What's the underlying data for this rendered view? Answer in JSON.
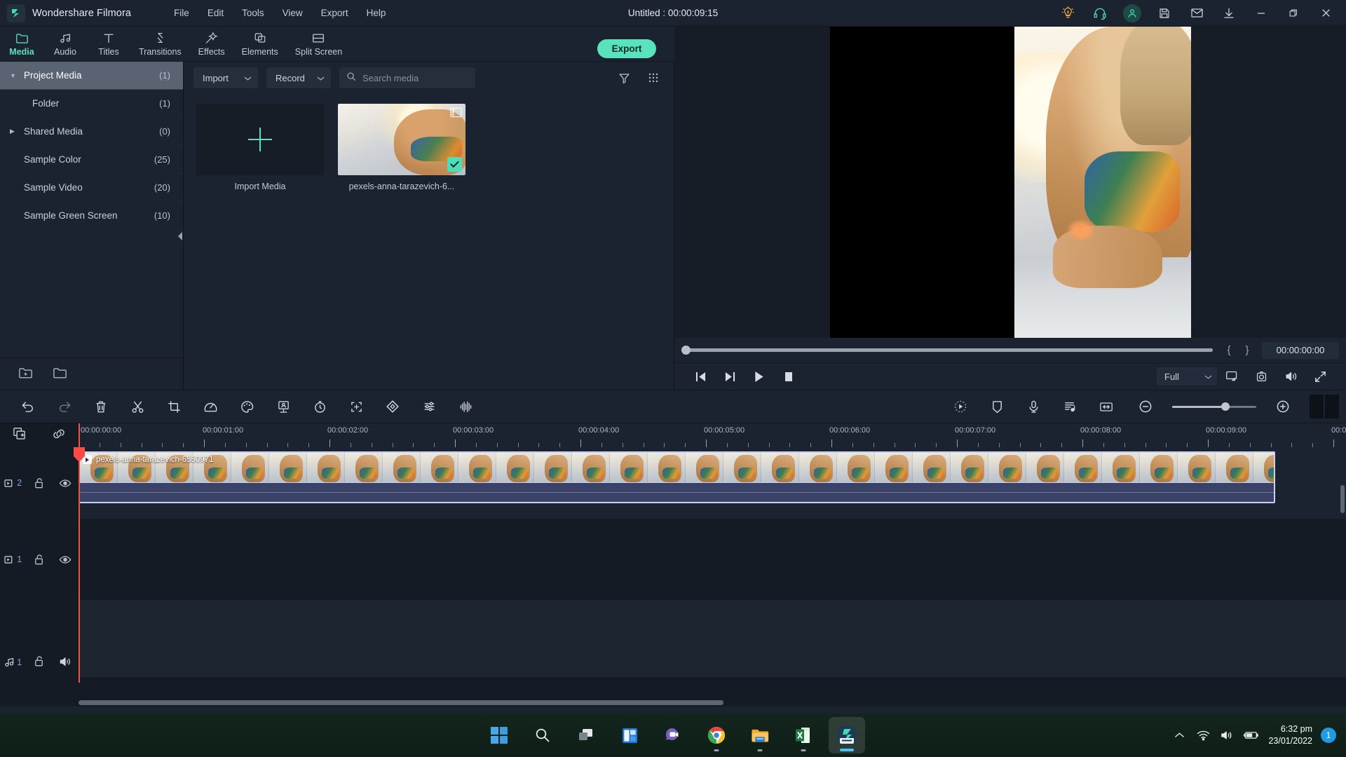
{
  "app": {
    "name": "Wondershare Filmora",
    "document_title": "Untitled : 00:00:09:15",
    "accent": "#5ee0c0",
    "playhead_color": "#ff4b43"
  },
  "menubar": {
    "items": [
      {
        "label": "File"
      },
      {
        "label": "Edit"
      },
      {
        "label": "Tools"
      },
      {
        "label": "View"
      },
      {
        "label": "Export"
      },
      {
        "label": "Help"
      }
    ]
  },
  "titlebar_actions": [
    {
      "name": "tips-lightbulb-icon",
      "label": "Tips",
      "color": "#f2a93b"
    },
    {
      "name": "headset-support-icon",
      "label": "Support",
      "color": "#4fd3b4"
    },
    {
      "name": "account-avatar-icon",
      "label": "Account",
      "color": "#4fd3b4"
    },
    {
      "name": "save-project-icon",
      "label": "Save",
      "color": "#c9d1dc"
    },
    {
      "name": "mail-icon",
      "label": "Feedback",
      "color": "#c9d1dc"
    },
    {
      "name": "download-icon",
      "label": "Downloads",
      "color": "#c9d1dc"
    }
  ],
  "window_controls": [
    {
      "name": "minimize-button",
      "label": "Minimize"
    },
    {
      "name": "maximize-button",
      "label": "Maximize"
    },
    {
      "name": "close-button",
      "label": "Close"
    }
  ],
  "ribbon": {
    "tabs": [
      {
        "label": "Media",
        "icon": "folder-icon",
        "active": true
      },
      {
        "label": "Audio",
        "icon": "music-notes-icon",
        "active": false
      },
      {
        "label": "Titles",
        "icon": "text-t-icon",
        "active": false
      },
      {
        "label": "Transitions",
        "icon": "transitions-arrows-icon",
        "active": false
      },
      {
        "label": "Effects",
        "icon": "magic-wand-icon",
        "active": false
      },
      {
        "label": "Elements",
        "icon": "layers-icon",
        "active": false
      },
      {
        "label": "Split Screen",
        "icon": "split-screen-icon",
        "active": false
      }
    ],
    "export_label": "Export"
  },
  "sidebar": {
    "items": [
      {
        "label": "Project Media",
        "count": "(1)",
        "arrow": "down",
        "active": true,
        "indent": false
      },
      {
        "label": "Folder",
        "count": "(1)",
        "arrow": "",
        "active": false,
        "indent": true
      },
      {
        "label": "Shared Media",
        "count": "(0)",
        "arrow": "right",
        "active": false,
        "indent": false
      },
      {
        "label": "Sample Color",
        "count": "(25)",
        "arrow": "",
        "active": false,
        "indent": false
      },
      {
        "label": "Sample Video",
        "count": "(20)",
        "arrow": "",
        "active": false,
        "indent": false
      },
      {
        "label": "Sample Green Screen",
        "count": "(10)",
        "arrow": "",
        "active": false,
        "indent": false
      }
    ],
    "footer": [
      {
        "name": "new-folder-icon",
        "label": "New Folder"
      },
      {
        "name": "open-folder-icon",
        "label": "Open Folder"
      }
    ],
    "collapse_icon": "collapse-left-icon"
  },
  "media_panel": {
    "import_label": "Import",
    "record_label": "Record",
    "search_placeholder": "Search media",
    "search_value": "",
    "filter_icon": "filter-funnel-icon",
    "grid_icon": "grid-dots-icon",
    "items": [
      {
        "type": "import",
        "caption": "Import Media",
        "selected": false
      },
      {
        "type": "video",
        "caption": "pexels-anna-tarazevich-6...",
        "selected": true
      }
    ]
  },
  "preview": {
    "current_timecode": "00:00:00:00",
    "mark_in_label": "{",
    "mark_out_label": "}",
    "quality_label": "Full",
    "scrub_position_percent": 0,
    "controls": [
      {
        "name": "prev-frame-button",
        "label": "Previous Frame"
      },
      {
        "name": "next-frame-button",
        "label": "Next Frame"
      },
      {
        "name": "play-button",
        "label": "Play"
      },
      {
        "name": "stop-button",
        "label": "Stop"
      }
    ],
    "right_controls": [
      {
        "name": "cast-to-device-icon",
        "label": "Play on Device"
      },
      {
        "name": "snapshot-camera-icon",
        "label": "Snapshot"
      },
      {
        "name": "volume-icon",
        "label": "Volume"
      },
      {
        "name": "fullscreen-icon",
        "label": "Full Screen"
      }
    ]
  },
  "edit_toolbar": {
    "left_tools": [
      {
        "name": "undo-icon",
        "label": "Undo"
      },
      {
        "name": "redo-icon",
        "label": "Redo"
      },
      {
        "name": "delete-trash-icon",
        "label": "Delete"
      },
      {
        "name": "split-scissors-icon",
        "label": "Split"
      },
      {
        "name": "crop-icon",
        "label": "Crop and Zoom"
      },
      {
        "name": "speed-gauge-icon",
        "label": "Speed"
      },
      {
        "name": "color-palette-icon",
        "label": "Color"
      },
      {
        "name": "green-screen-icon",
        "label": "Green Screen"
      },
      {
        "name": "timer-icon",
        "label": "Duration"
      },
      {
        "name": "motion-tracking-icon",
        "label": "Motion Tracking"
      },
      {
        "name": "keyframe-diamond-icon",
        "label": "Keyframe"
      },
      {
        "name": "audio-mixer-icon",
        "label": "Audio Mixer"
      },
      {
        "name": "audio-waveform-icon",
        "label": "Audio Equalizer"
      }
    ],
    "right_tools": [
      {
        "name": "render-preview-icon",
        "label": "Render Preview"
      },
      {
        "name": "marker-shield-icon",
        "label": "Marker"
      },
      {
        "name": "voiceover-mic-icon",
        "label": "Record Voiceover"
      },
      {
        "name": "detach-audio-icon",
        "label": "Detach Audio"
      },
      {
        "name": "fit-timeline-icon",
        "label": "Zoom to Fit Timeline"
      }
    ],
    "zoom_out_label": "−",
    "zoom_in_label": "+",
    "zoom_percent": 62
  },
  "timeline": {
    "add-track_icon": "add-track-icon",
    "link_icon": "link-chain-icon",
    "ruler_labels": [
      "00:00:00:00",
      "00:00:01:00",
      "00:00:02:00",
      "00:00:03:00",
      "00:00:04:00",
      "00:00:05:00",
      "00:00:06:00",
      "00:00:07:00",
      "00:00:08:00",
      "00:00:09:00",
      "00:0"
    ],
    "playhead_timecode": "00:00:00:00",
    "tracks": [
      {
        "id": "video-2",
        "type": "video",
        "number": "2",
        "lock_icon": "unlock-icon",
        "visibility_icon": "eye-icon",
        "clip": {
          "title": "pexels-anna-tarazevich-6550971",
          "selected": true
        }
      },
      {
        "id": "video-1",
        "type": "video",
        "number": "1",
        "lock_icon": "unlock-icon",
        "visibility_icon": "eye-icon",
        "clip": null
      },
      {
        "id": "audio-1",
        "type": "audio",
        "number": "1",
        "lock_icon": "unlock-icon",
        "visibility_icon": "speaker-icon",
        "clip": null
      }
    ]
  },
  "taskbar": {
    "apps": [
      {
        "name": "windows-start-icon",
        "label": "Start",
        "running": false,
        "active": false
      },
      {
        "name": "search-icon",
        "label": "Search",
        "running": false,
        "active": false
      },
      {
        "name": "task-view-icon",
        "label": "Task View",
        "running": false,
        "active": false
      },
      {
        "name": "widgets-icon",
        "label": "Widgets",
        "running": false,
        "active": false
      },
      {
        "name": "teams-chat-icon",
        "label": "Chat",
        "running": false,
        "active": false
      },
      {
        "name": "chrome-icon",
        "label": "Google Chrome",
        "running": true,
        "active": false
      },
      {
        "name": "file-explorer-icon",
        "label": "File Explorer",
        "running": true,
        "active": false
      },
      {
        "name": "excel-icon",
        "label": "Microsoft Excel",
        "running": true,
        "active": false
      },
      {
        "name": "filmora-icon",
        "label": "Wondershare Filmora",
        "running": true,
        "active": true
      }
    ],
    "tray": [
      {
        "name": "chevron-up-icon",
        "label": "Show hidden icons"
      },
      {
        "name": "wifi-icon",
        "label": "Network"
      },
      {
        "name": "volume-icon",
        "label": "Volume"
      },
      {
        "name": "battery-charging-icon",
        "label": "Battery"
      }
    ],
    "time": "6:32 pm",
    "date": "23/01/2022",
    "notification_count": "1"
  }
}
